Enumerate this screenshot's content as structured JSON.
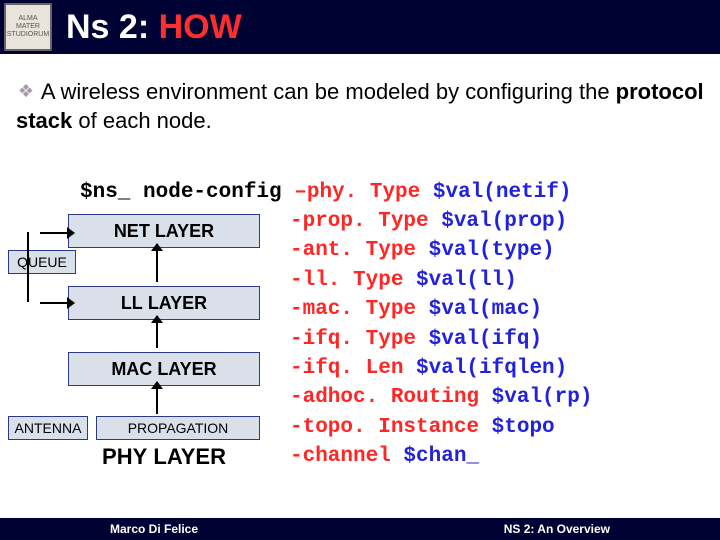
{
  "title": {
    "prefix": "Ns 2: ",
    "highlight": "HOW"
  },
  "bullet": {
    "pre": " A wireless environment can be modeled by configuring the ",
    "bold": "protocol stack",
    "post": " of each node."
  },
  "stack": {
    "net": "NET LAYER",
    "queue": "QUEUE",
    "ll": "LL LAYER",
    "mac": "MAC LAYER",
    "antenna": "ANTENNA",
    "propagation": "PROPAGATION",
    "phy": "PHY LAYER"
  },
  "code": {
    "line1": {
      "a": "$ns_ node-config",
      "b": " –phy. Type",
      "c": " $val(netif)"
    },
    "rest": [
      {
        "flag": "-prop. Type",
        "arg": " $val(prop)"
      },
      {
        "flag": "-ant. Type",
        "arg": " $val(type)"
      },
      {
        "flag": "-ll. Type",
        "arg": " $val(ll)"
      },
      {
        "flag": "-mac. Type",
        "arg": " $val(mac)"
      },
      {
        "flag": "-ifq. Type",
        "arg": " $val(ifq)"
      },
      {
        "flag": "-ifq. Len",
        "arg": " $val(ifqlen)"
      },
      {
        "flag": "-adhoc. Routing",
        "arg": " $val(rp)"
      },
      {
        "flag": "-topo. Instance",
        "arg": " $topo"
      },
      {
        "flag": "-channel",
        "arg": " $chan_"
      }
    ]
  },
  "footer": {
    "left": "Marco Di Felice",
    "right": "NS 2: An Overview"
  }
}
